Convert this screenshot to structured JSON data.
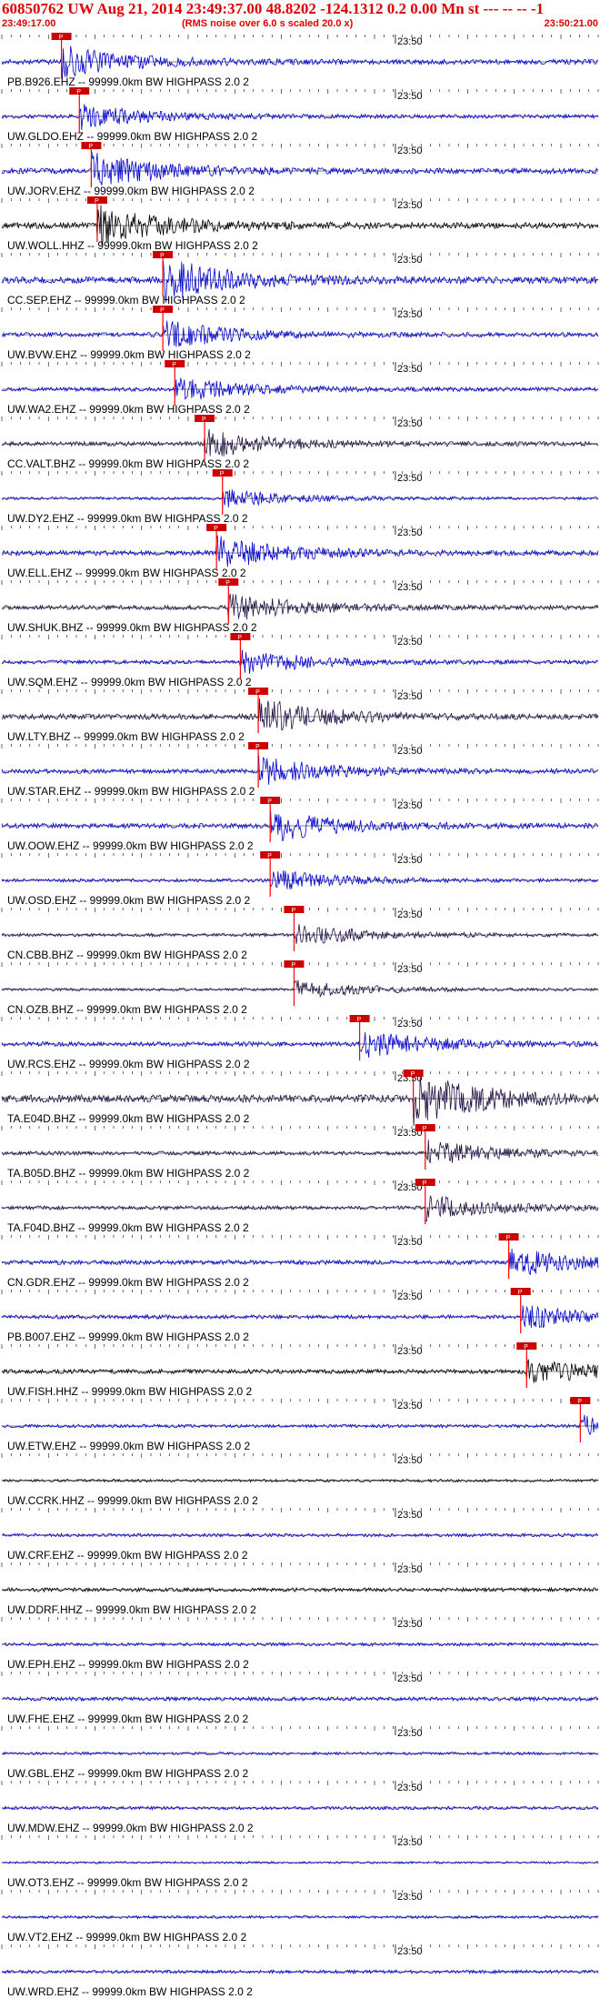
{
  "header": {
    "title": "60850762 UW Aug 21, 2014 23:49:37.00   48.8202 -124.1312  0.2 0.00 Mn st --- -- -- -1",
    "start_time": "23:49:17.00",
    "note": "(RMS noise over 6.0 s scaled 20.0 x)",
    "end_time": "23:50:21.00"
  },
  "chart_data": {
    "type": "line",
    "title": "60850762 UW Aug 21, 2014 23:49:37.00   48.8202 -124.1312  0.2 0.00 Mn st --- -- -- -1",
    "x_range": [
      "23:49:17.00",
      "23:50:21.00"
    ],
    "tick_label": "23:50",
    "pick_label": "P",
    "colors": {
      "blue": "#0000cc",
      "black": "#000000",
      "dark": "#221144",
      "pick": "#ff0000",
      "pick_box": "#cc0000"
    },
    "series": [
      {
        "label": "PB.B926.EHZ -- 99999.0km BW  HIGHPASS  2.0  2",
        "color": "blue",
        "amp": 0.45,
        "pick": 0.1
      },
      {
        "label": "UW.GLDO.EHZ -- 99999.0km BW  HIGHPASS  2.0  2",
        "color": "blue",
        "amp": 0.35,
        "pick": 0.13
      },
      {
        "label": "UW.JORV.EHZ -- 99999.0km BW  HIGHPASS  2.0  2",
        "color": "blue",
        "amp": 0.5,
        "pick": 0.15
      },
      {
        "label": "UW.WOLL.HHZ -- 99999.0km BW  HIGHPASS  2.0  2",
        "color": "black",
        "amp": 0.55,
        "pick": 0.16
      },
      {
        "label": "CC.SEP.EHZ -- 99999.0km BW  HIGHPASS  2.0  2",
        "color": "blue",
        "amp": 0.6,
        "pick": 0.27
      },
      {
        "label": "UW.BVW.EHZ -- 99999.0km BW  HIGHPASS  2.0  2",
        "color": "blue",
        "amp": 0.4,
        "pick": 0.27
      },
      {
        "label": "UW.WA2.EHZ -- 99999.0km BW  HIGHPASS  2.0  2",
        "color": "blue",
        "amp": 0.35,
        "pick": 0.29
      },
      {
        "label": "CC.VALT.BHZ -- 99999.0km BW  HIGHPASS  2.0  2",
        "color": "dark",
        "amp": 0.4,
        "pick": 0.34
      },
      {
        "label": "UW.DY2.EHZ -- 99999.0km BW  HIGHPASS  2.0  2",
        "color": "blue",
        "amp": 0.25,
        "pick": 0.37
      },
      {
        "label": "UW.ELL.EHZ -- 99999.0km BW  HIGHPASS  2.0  2",
        "color": "blue",
        "amp": 0.45,
        "pick": 0.36
      },
      {
        "label": "UW.SHUK.BHZ -- 99999.0km BW  HIGHPASS  2.0  2",
        "color": "dark",
        "amp": 0.4,
        "pick": 0.38
      },
      {
        "label": "UW.SQM.EHZ -- 99999.0km BW  HIGHPASS  2.0  2",
        "color": "blue",
        "amp": 0.35,
        "pick": 0.4
      },
      {
        "label": "UW.LTY.BHZ -- 99999.0km BW  HIGHPASS  2.0  2",
        "color": "dark",
        "amp": 0.5,
        "pick": 0.43
      },
      {
        "label": "UW.STAR.EHZ -- 99999.0km BW  HIGHPASS  2.0  2",
        "color": "blue",
        "amp": 0.4,
        "pick": 0.43
      },
      {
        "label": "UW.OOW.EHZ -- 99999.0km BW  HIGHPASS  2.0  2",
        "color": "blue",
        "amp": 0.45,
        "pick": 0.45
      },
      {
        "label": "UW.OSD.EHZ -- 99999.0km BW  HIGHPASS  2.0  2",
        "color": "blue",
        "amp": 0.3,
        "pick": 0.45
      },
      {
        "label": "CN.CBB.BHZ -- 99999.0km BW  HIGHPASS  2.0  2",
        "color": "dark",
        "amp": 0.3,
        "pick": 0.49
      },
      {
        "label": "CN.OZB.BHZ -- 99999.0km BW  HIGHPASS  2.0  2",
        "color": "dark",
        "amp": 0.25,
        "pick": 0.49
      },
      {
        "label": "UW.RCS.EHZ -- 99999.0km BW  HIGHPASS  2.0  2",
        "color": "blue",
        "amp": 0.4,
        "pick": 0.6
      },
      {
        "label": "TA.E04D.BHZ -- 99999.0km BW  HIGHPASS  2.0  2",
        "color": "dark",
        "amp": 0.7,
        "pick": 0.69
      },
      {
        "label": "TA.B05D.BHZ -- 99999.0km BW  HIGHPASS  2.0  2",
        "color": "dark",
        "amp": 0.35,
        "pick": 0.71
      },
      {
        "label": "TA.F04D.BHZ -- 99999.0km BW  HIGHPASS  2.0  2",
        "color": "dark",
        "amp": 0.35,
        "pick": 0.71
      },
      {
        "label": "CN.GDR.EHZ -- 99999.0km BW  HIGHPASS  2.0  2",
        "color": "blue",
        "amp": 0.4,
        "pick": 0.85
      },
      {
        "label": "PB.B007.EHZ -- 99999.0km BW  HIGHPASS  2.0  2",
        "color": "blue",
        "amp": 0.35,
        "pick": 0.87
      },
      {
        "label": "UW.FISH.HHZ -- 99999.0km BW  HIGHPASS  2.0  2",
        "color": "black",
        "amp": 0.4,
        "pick": 0.88
      },
      {
        "label": "UW.ETW.EHZ -- 99999.0km BW  HIGHPASS  2.0  2",
        "color": "blue",
        "amp": 0.3,
        "pick": 0.97
      },
      {
        "label": "UW.CCRK.HHZ -- 99999.0km BW  HIGHPASS  2.0  2",
        "color": "black",
        "amp": 0.25,
        "pick": null
      },
      {
        "label": "UW.CRF.EHZ -- 99999.0km BW  HIGHPASS  2.0  2",
        "color": "blue",
        "amp": 0.3,
        "pick": null
      },
      {
        "label": "UW.DDRF.HHZ -- 99999.0km BW  HIGHPASS  2.0  2",
        "color": "black",
        "amp": 0.35,
        "pick": null
      },
      {
        "label": "UW.EPH.EHZ -- 99999.0km BW  HIGHPASS  2.0  2",
        "color": "blue",
        "amp": 0.3,
        "pick": null
      },
      {
        "label": "UW.FHE.EHZ -- 99999.0km BW  HIGHPASS  2.0  2",
        "color": "blue",
        "amp": 0.35,
        "pick": null
      },
      {
        "label": "UW.GBL.EHZ -- 99999.0km BW  HIGHPASS  2.0  2",
        "color": "blue",
        "amp": 0.25,
        "pick": null
      },
      {
        "label": "UW.MDW.EHZ -- 99999.0km BW  HIGHPASS  2.0  2",
        "color": "blue",
        "amp": 0.3,
        "pick": null
      },
      {
        "label": "UW.OT3.EHZ -- 99999.0km BW  HIGHPASS  2.0  2",
        "color": "blue",
        "amp": 0.2,
        "pick": null
      },
      {
        "label": "UW.VT2.EHZ -- 99999.0km BW  HIGHPASS  2.0  2",
        "color": "blue",
        "amp": 0.25,
        "pick": null
      },
      {
        "label": "UW.WRD.EHZ -- 99999.0km BW  HIGHPASS  2.0  2",
        "color": "blue",
        "amp": 0.3,
        "pick": null
      }
    ]
  }
}
